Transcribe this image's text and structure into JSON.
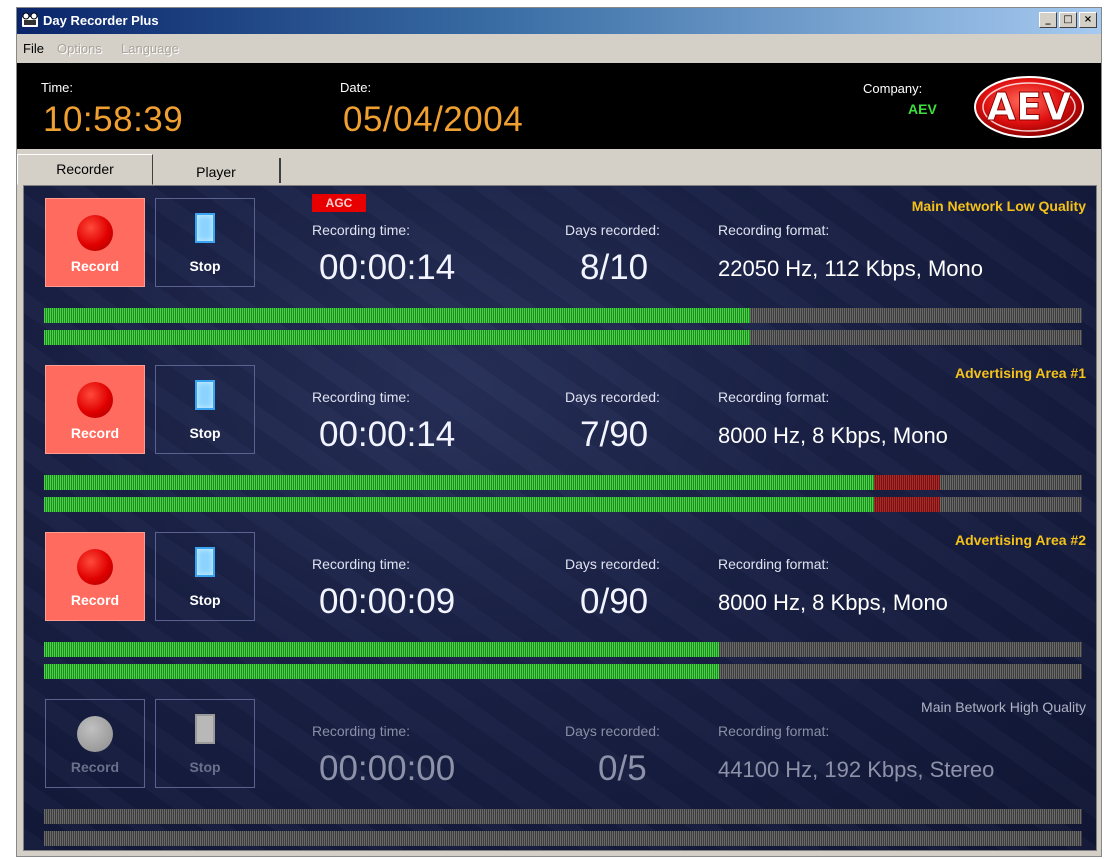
{
  "window": {
    "title": "Day Recorder Plus",
    "controls": [
      "_",
      "□",
      "×"
    ]
  },
  "menu": [
    {
      "label": "File",
      "enabled": true
    },
    {
      "label": "Options",
      "enabled": false
    },
    {
      "label": "Language",
      "enabled": false
    }
  ],
  "header": {
    "time_label": "Time:",
    "time_value": "10:58:39",
    "date_label": "Date:",
    "date_value": "05/04/2004",
    "company_label": "Company:",
    "company_value": "AEV",
    "logo_text": "AEV"
  },
  "tabs": [
    {
      "label": "Recorder",
      "active": true
    },
    {
      "label": "Player",
      "active": false
    }
  ],
  "common": {
    "record_label": "Record",
    "stop_label": "Stop",
    "recording_time_label": "Recording time:",
    "days_recorded_label": "Days recorded:",
    "recording_format_label": "Recording format:",
    "agc_label": "AGC"
  },
  "channels": [
    {
      "name": "Main Network Low Quality",
      "recording_time": "00:00:14",
      "days_recorded": "8/10",
      "format": "22050 Hz, 112 Kbps, Mono",
      "active": true,
      "agc": true,
      "meters": [
        {
          "green_pct": 68,
          "red_pct": 0
        },
        {
          "green_pct": 68,
          "red_pct": 0
        }
      ]
    },
    {
      "name": "Advertising Area #1",
      "recording_time": "00:00:14",
      "days_recorded": "7/90",
      "format": "8000 Hz, 8 Kbps, Mono",
      "active": true,
      "agc": false,
      "meters": [
        {
          "green_pct": 80,
          "red_pct": 6.3
        },
        {
          "green_pct": 80,
          "red_pct": 6.3
        }
      ]
    },
    {
      "name": "Advertising Area #2",
      "recording_time": "00:00:09",
      "days_recorded": "0/90",
      "format": "8000 Hz, 8 Kbps, Mono",
      "active": true,
      "agc": false,
      "meters": [
        {
          "green_pct": 65,
          "red_pct": 0
        },
        {
          "green_pct": 65,
          "red_pct": 0
        }
      ]
    },
    {
      "name": "Main Betwork High Quality",
      "recording_time": "00:00:00",
      "days_recorded": "0/5",
      "format": "44100 Hz, 192 Kbps, Stereo",
      "active": false,
      "agc": false,
      "meters": [
        {
          "green_pct": 0,
          "red_pct": 0
        },
        {
          "green_pct": 0,
          "red_pct": 0
        }
      ]
    }
  ],
  "colors": {
    "time_value": "#f0a030",
    "company_value": "#3ce03c",
    "channel_name": "#f5c21a",
    "record_button": "#ff6b5e",
    "meter_green": "#4ad24a",
    "meter_red": "#b02828",
    "agc_badge": "#e80000"
  },
  "icons": [
    "app-icon",
    "record-dot-icon",
    "stop-square-icon",
    "aev-logo"
  ]
}
